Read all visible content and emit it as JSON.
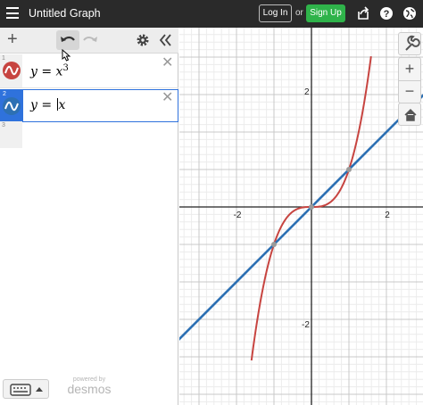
{
  "header": {
    "title": "Untitled Graph",
    "login_label": "Log In",
    "or_label": "or",
    "signup_label": "Sign Up",
    "icons": [
      "share-icon",
      "help-icon",
      "globe-icon"
    ]
  },
  "expression_list": {
    "toolbar": {
      "add_label": "+",
      "icons": [
        "undo-icon",
        "redo-icon",
        "settings-gear-icon",
        "collapse-icon"
      ]
    },
    "expressions": [
      {
        "index": "1",
        "latex": "y = x",
        "exponent": "3",
        "color": "#c74440"
      },
      {
        "index": "2",
        "latex_before": "y = ",
        "latex_after": "x",
        "color": "#2d70b3",
        "active": true
      }
    ],
    "next_index": "3"
  },
  "footer": {
    "powered_by": "powered by",
    "brand": "desmos"
  },
  "graph": {
    "x_ticks": [
      "-2",
      "2"
    ],
    "y_ticks": [
      "2",
      "-2"
    ],
    "functions": [
      "y=x^3",
      "y=x"
    ],
    "x_range": [
      -3.5,
      3.0
    ],
    "y_range": [
      -3.5,
      3.5
    ],
    "colors": {
      "red": "#c74440",
      "blue": "#2d70b3"
    },
    "zoom_controls": [
      "+",
      "−"
    ]
  }
}
